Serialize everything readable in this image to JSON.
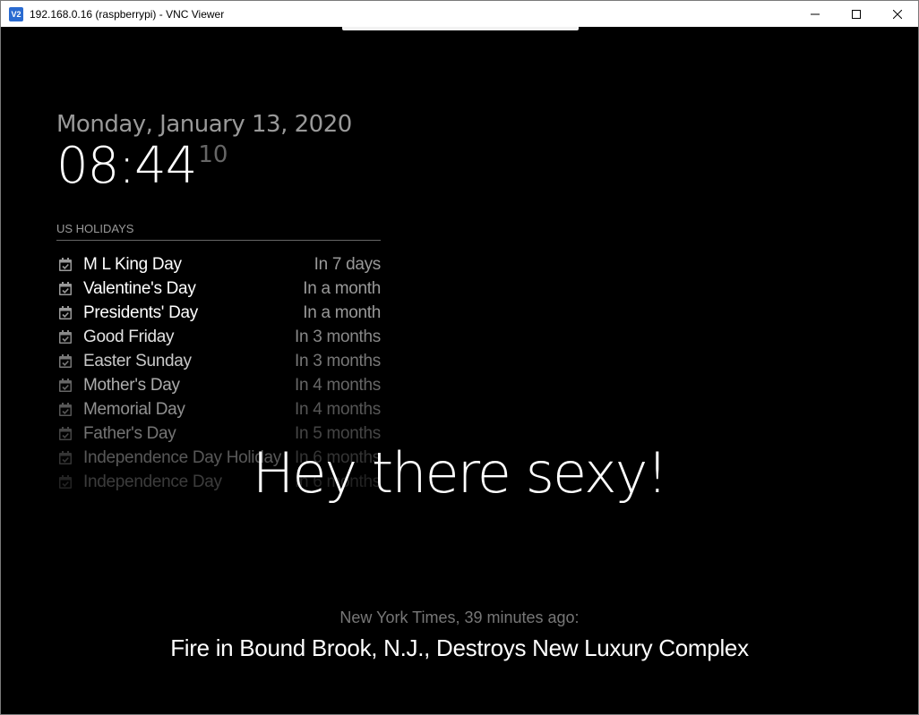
{
  "window": {
    "app_icon": "V2",
    "title": "192.168.0.16 (raspberrypi) - VNC Viewer"
  },
  "clock": {
    "date": "Monday, January 13, 2020",
    "time": "08:44",
    "seconds": "10"
  },
  "holidays": {
    "header": "US HOLIDAYS",
    "icon": "calendar-check-icon",
    "items": [
      {
        "name": "M L King Day",
        "when": "In 7 days"
      },
      {
        "name": "Valentine's Day",
        "when": "In a month"
      },
      {
        "name": "Presidents' Day",
        "when": "In a month"
      },
      {
        "name": "Good Friday",
        "when": "In 3 months"
      },
      {
        "name": "Easter Sunday",
        "when": "In 3 months"
      },
      {
        "name": "Mother's Day",
        "when": "In 4 months"
      },
      {
        "name": "Memorial Day",
        "when": "In 4 months"
      },
      {
        "name": "Father's Day",
        "when": "In 5 months"
      },
      {
        "name": "Independence Day Holiday",
        "when": "In 6 months"
      },
      {
        "name": "Independence Day",
        "when": "In 6 months"
      }
    ]
  },
  "compliment": "Hey there sexy!",
  "news": {
    "source": "New York Times, 39 minutes ago:",
    "headline": "Fire in Bound Brook, N.J., Destroys New Luxury Complex"
  },
  "colors": {
    "background": "#000000",
    "primary_text": "#ffffff",
    "dimmed_text": "#999999"
  }
}
